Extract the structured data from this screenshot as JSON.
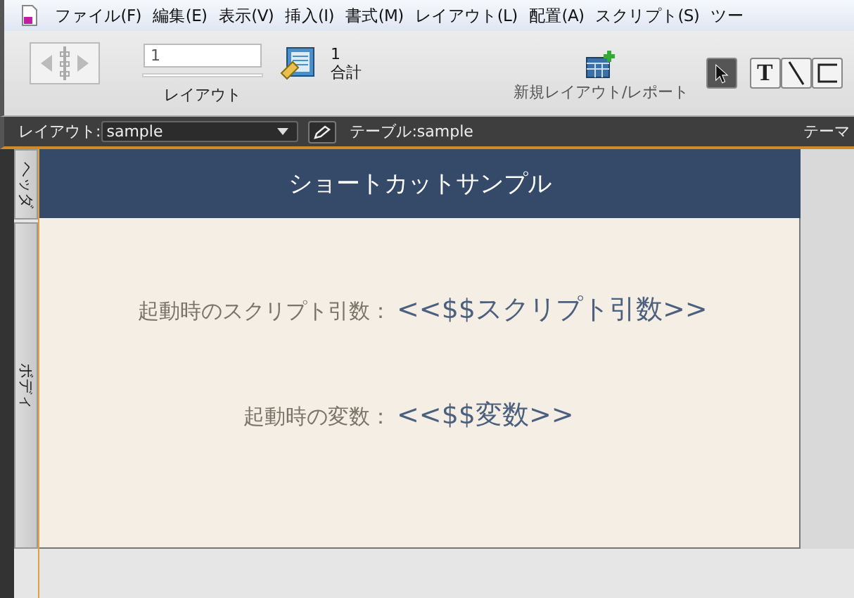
{
  "menu": [
    "ファイル(F)",
    "編集(E)",
    "表示(V)",
    "挿入(I)",
    "書式(M)",
    "レイアウト(L)",
    "配置(A)",
    "スクリプト(S)",
    "ツー"
  ],
  "toolbar": {
    "record": "1",
    "record_label": "レイアウト",
    "found": "1",
    "total": "合計",
    "new_layout": "新規レイアウト/レポート",
    "tools": [
      {
        "kind": "pointer",
        "selected": true
      },
      {
        "kind": "text",
        "glyph": "T",
        "selected": false
      },
      {
        "kind": "line",
        "selected": false
      },
      {
        "kind": "rectangle",
        "selected": false
      }
    ]
  },
  "layout_bar": {
    "label": "レイアウト:",
    "layout": "sample",
    "table": "テーブル:sample",
    "theme": "テーマ"
  },
  "parts": [
    {
      "label": "ヘッダ"
    },
    {
      "label": "ボディ"
    }
  ],
  "header_title": "ショートカットサンプル",
  "fields": [
    {
      "label": "起動時のスクリプト引数：",
      "value": "<<$$スクリプト引数>>"
    },
    {
      "label": "起動時の変数：",
      "value": "<<$$変数>>"
    }
  ]
}
